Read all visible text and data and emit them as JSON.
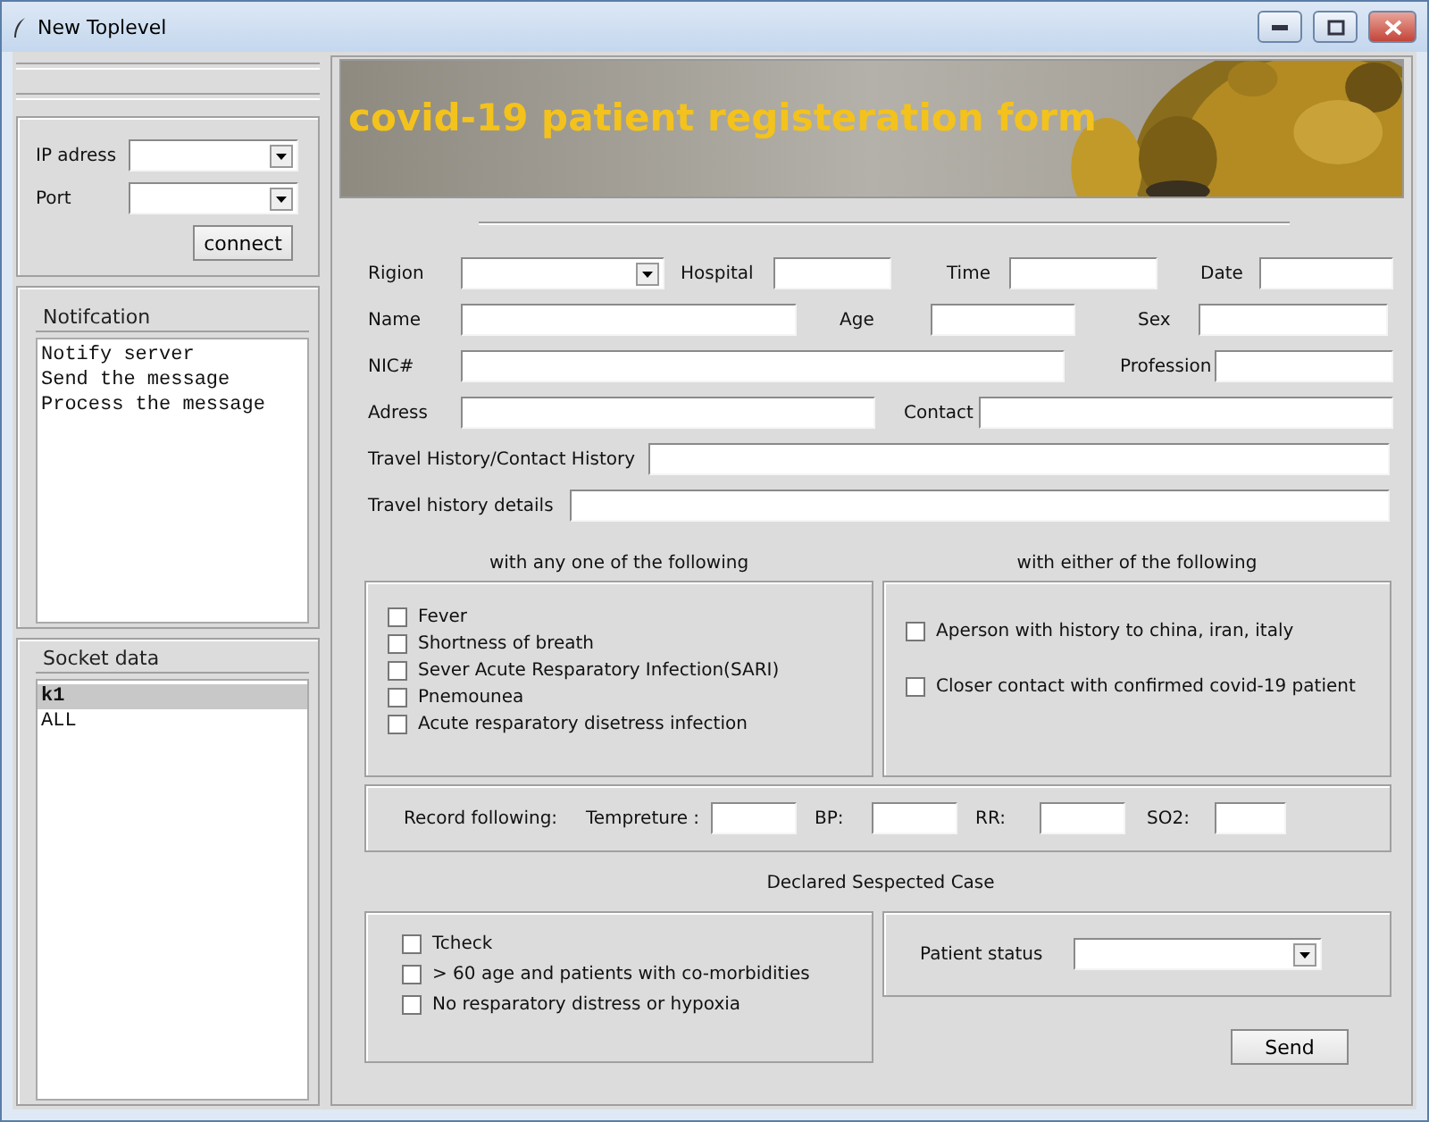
{
  "window": {
    "title": "New Toplevel"
  },
  "connection": {
    "ip_label": "IP adress",
    "port_label": "Port",
    "connect_button": "connect"
  },
  "notification": {
    "title": "Notifcation",
    "lines": [
      "Notify server",
      "Send the message",
      "Process the message"
    ]
  },
  "socket_data": {
    "title": "Socket data",
    "items": [
      {
        "text": "k1",
        "selected": true
      },
      {
        "text": "ALL",
        "selected": false
      }
    ]
  },
  "banner": {
    "title": "covid-19 patient registeration form"
  },
  "form_rows": [
    [
      {
        "label": "Rigion",
        "kind": "combo"
      },
      {
        "label": "Hospital",
        "kind": "text"
      },
      {
        "label": "Time",
        "kind": "text"
      },
      {
        "label": "Date",
        "kind": "text"
      }
    ],
    [
      {
        "label": "Name",
        "kind": "text"
      },
      {
        "label": "Age",
        "kind": "text"
      },
      {
        "label": "Sex",
        "kind": "text"
      }
    ],
    [
      {
        "label": "NIC#",
        "kind": "text"
      },
      {
        "label": "Profession",
        "kind": "text"
      }
    ],
    [
      {
        "label": "Adress",
        "kind": "text"
      },
      {
        "label": "Contact",
        "kind": "text"
      }
    ],
    [
      {
        "label": "Travel History/Contact History",
        "kind": "text"
      }
    ],
    [
      {
        "label": "Travel history details",
        "kind": "text"
      }
    ]
  ],
  "symptoms": {
    "heading": "with any one of the following",
    "items": [
      {
        "label": "Fever",
        "checked": false
      },
      {
        "label": "Shortness of breath",
        "checked": false
      },
      {
        "label": "Sever Acute Resparatory Infection(SARI)",
        "checked": false
      },
      {
        "label": "Pnemounea",
        "checked": false
      },
      {
        "label": "Acute resparatory disetress infection",
        "checked": false
      }
    ]
  },
  "exposure": {
    "heading": "with either of the following",
    "items": [
      {
        "label": "Aperson with history to china, iran, italy",
        "checked": false
      },
      {
        "label": "Closer contact with confirmed covid-19 patient",
        "checked": false
      }
    ]
  },
  "vitals": {
    "label": "Record following:",
    "fields": [
      {
        "label": "Tempreture :"
      },
      {
        "label": "BP:"
      },
      {
        "label": "RR:"
      },
      {
        "label": "SO2:"
      }
    ]
  },
  "declared": {
    "heading": "Declared Sespected Case",
    "items": [
      {
        "label": "Tcheck",
        "checked": false
      },
      {
        "label": "> 60 age and patients with co-morbidities",
        "checked": false
      },
      {
        "label": "No resparatory distress or hypoxia",
        "checked": false
      }
    ],
    "status_label": "Patient status"
  },
  "send_button": "Send"
}
